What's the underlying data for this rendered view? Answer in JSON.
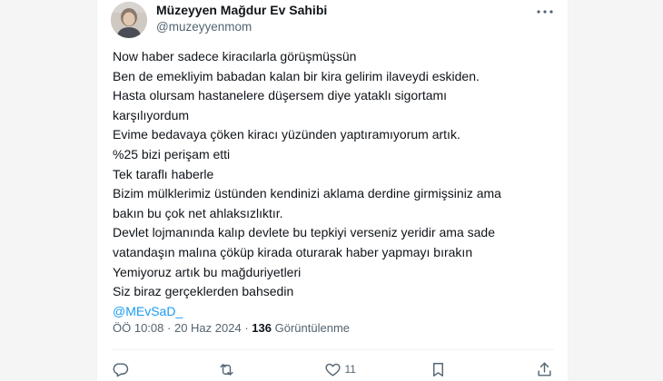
{
  "user": {
    "display_name": "Müzeyyen Mağdur Ev Sahibi",
    "handle": "@muzeyyenmom"
  },
  "tweet": {
    "lines": [
      "Now haber  sadece kiracılarla görüşmüşsün",
      "Ben de emekliyim babadan kalan bir kira gelirim ilaveydi eskiden.",
      "Hasta olursam hastanelere düşersem diye yataklı sigortamı",
      "karşılıyordum",
      "Evime bedavaya çöken kiracı yüzünden yaptıramıyorum  artık.",
      "%25 bizi perişam etti",
      "Tek taraflı haberle",
      "Bizim mülklerimiz üstünden kendinizi aklama derdine girmişsiniz ama",
      "bakın bu çok net ahlaksızlıktır.",
      "Devlet lojmanında kalıp devlete bu tepkiyi verseniz yeridir ama sade",
      "vatandaşın malına çöküp kirada oturarak haber yapmayı bırakın",
      "Yemiyoruz artık bu mağduriyetleri",
      "Siz biraz gerçeklerden bahsedin"
    ],
    "mention": "@MEvSaD_"
  },
  "meta": {
    "time": "ÖÖ 10:08",
    "separator": "·",
    "date": "20 Haz 2024",
    "views_count": "136",
    "views_label": "Görüntülenme"
  },
  "actions": {
    "reply_icon": "reply-icon",
    "retweet_icon": "retweet-icon",
    "like_icon": "heart-icon",
    "like_count": "11",
    "bookmark_icon": "bookmark-icon",
    "share_icon": "share-icon"
  },
  "colors": {
    "text": "#0f1419",
    "secondary": "#536471",
    "link": "#1d9bf0",
    "border": "#eff3f4"
  }
}
